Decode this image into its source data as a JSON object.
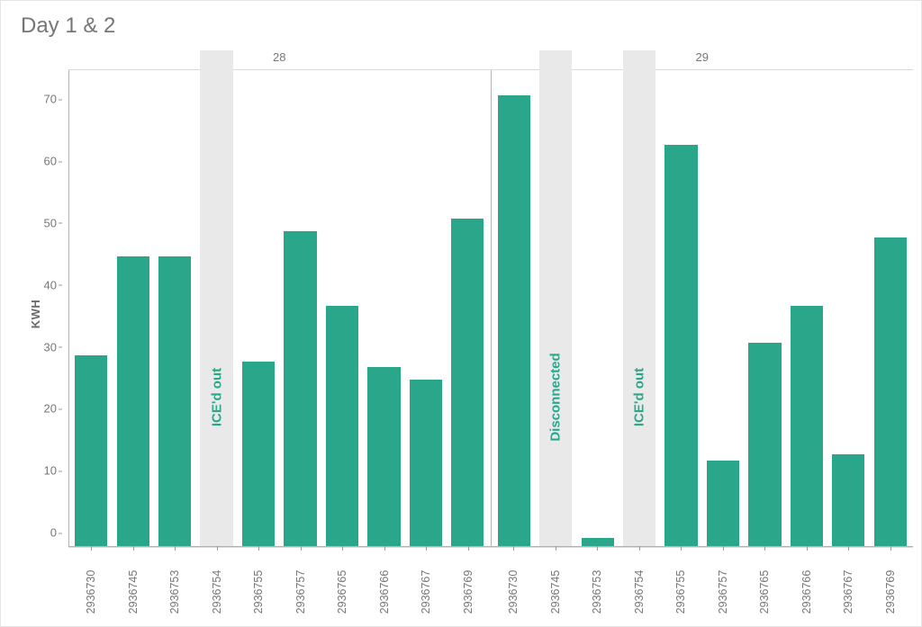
{
  "title": "Day 1 & 2",
  "ylabel": "KWH",
  "y_ticks": [
    0,
    10,
    20,
    30,
    40,
    50,
    60,
    70
  ],
  "y_max": 77,
  "colors": {
    "bar": "#2aa78b",
    "ghost": "#e9e9e9"
  },
  "chart_data": {
    "type": "bar",
    "ylabel": "KWH",
    "ylim": [
      0,
      77
    ],
    "panels": [
      {
        "name": "28",
        "bars": [
          {
            "id": "2936730",
            "value": 31
          },
          {
            "id": "2936745",
            "value": 47
          },
          {
            "id": "2936753",
            "value": 47
          },
          {
            "id": "2936754",
            "value": null,
            "status": "ICE'd out"
          },
          {
            "id": "2936755",
            "value": 30
          },
          {
            "id": "2936757",
            "value": 51
          },
          {
            "id": "2936765",
            "value": 39
          },
          {
            "id": "2936766",
            "value": 29
          },
          {
            "id": "2936767",
            "value": 27
          },
          {
            "id": "2936769",
            "value": 53
          }
        ]
      },
      {
        "name": "29",
        "bars": [
          {
            "id": "2936730",
            "value": 73
          },
          {
            "id": "2936745",
            "value": null,
            "status": "Disconnected"
          },
          {
            "id": "2936753",
            "value": 1.5
          },
          {
            "id": "2936754",
            "value": null,
            "status": "ICE'd out"
          },
          {
            "id": "2936755",
            "value": 65
          },
          {
            "id": "2936757",
            "value": 14
          },
          {
            "id": "2936765",
            "value": 33
          },
          {
            "id": "2936766",
            "value": 39
          },
          {
            "id": "2936767",
            "value": 15
          },
          {
            "id": "2936769",
            "value": 50
          }
        ]
      }
    ]
  }
}
